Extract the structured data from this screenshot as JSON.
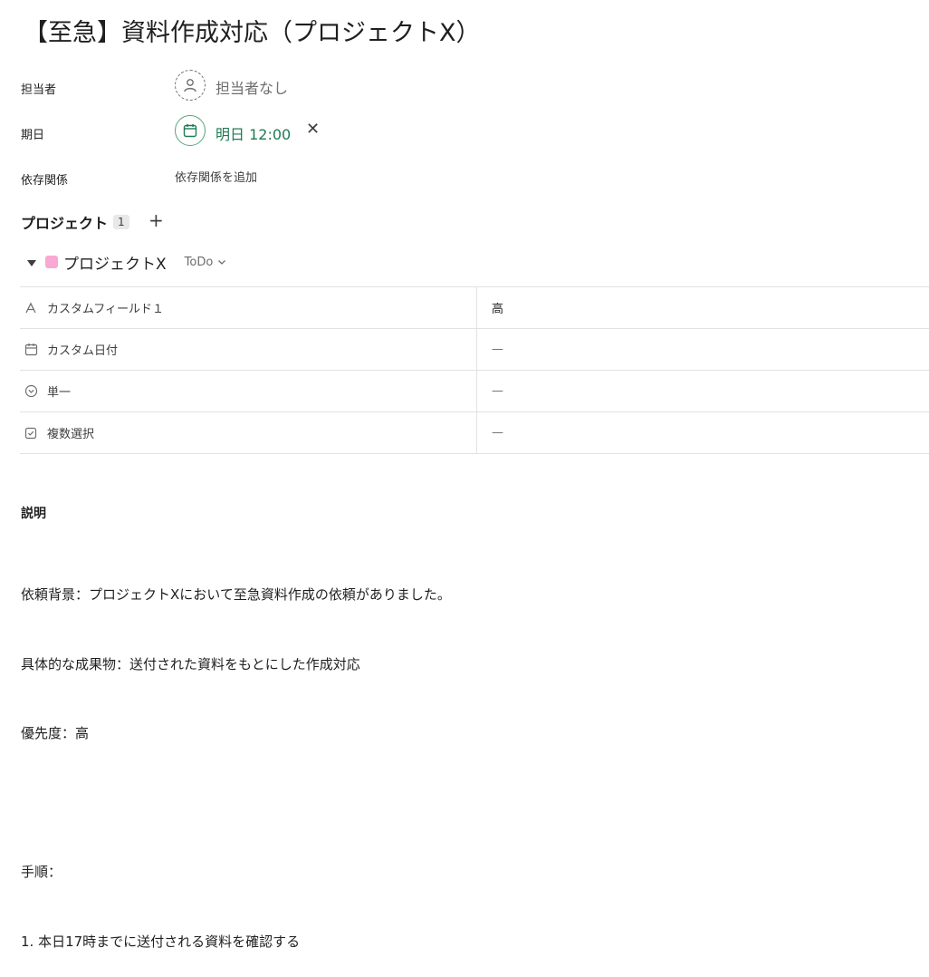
{
  "task": {
    "title": "【至急】資料作成対応（プロジェクトX）"
  },
  "assignee": {
    "label": "担当者",
    "value": "担当者なし"
  },
  "due": {
    "label": "期日",
    "value": "明日 12:00"
  },
  "dependencies": {
    "label": "依存関係",
    "add_link": "依存関係を追加"
  },
  "projects": {
    "title": "プロジェクト",
    "count": "1",
    "items": [
      {
        "name": "プロジェクトX",
        "status": "ToDo",
        "color": "#f9a8d4"
      }
    ]
  },
  "fields": [
    {
      "icon": "text-a-icon",
      "name": "カスタムフィールド１",
      "value": "高"
    },
    {
      "icon": "calendar-icon",
      "name": "カスタム日付",
      "value": "—"
    },
    {
      "icon": "chevron-circle-icon",
      "name": "単一",
      "value": "—"
    },
    {
      "icon": "checkbox-icon",
      "name": "複数選択",
      "value": "—"
    }
  ],
  "description": {
    "title": "説明",
    "lines": [
      "依頼背景：プロジェクトXにおいて至急資料作成の依頼がありました。",
      "具体的な成果物：送付された資料をもとにした作成対応",
      "優先度：高",
      "",
      "手順：",
      "1. 本日17時までに送付される資料を確認する"
    ]
  }
}
